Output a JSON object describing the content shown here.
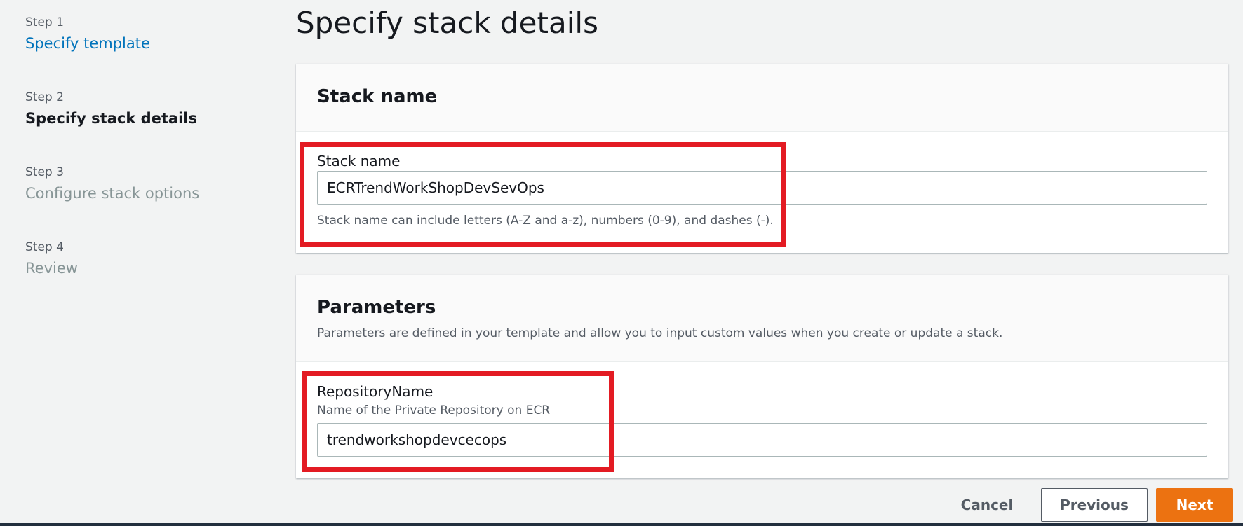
{
  "wizard": {
    "steps": [
      {
        "number": "Step 1",
        "title": "Specify template"
      },
      {
        "number": "Step 2",
        "title": "Specify stack details"
      },
      {
        "number": "Step 3",
        "title": "Configure stack options"
      },
      {
        "number": "Step 4",
        "title": "Review"
      }
    ]
  },
  "page": {
    "title": "Specify stack details"
  },
  "stack_name_section": {
    "header": "Stack name",
    "label": "Stack name",
    "value": "ECRTrendWorkShopDevSevOps",
    "hint": "Stack name can include letters (A-Z and a-z), numbers (0-9), and dashes (-)."
  },
  "parameters_section": {
    "header": "Parameters",
    "description": "Parameters are defined in your template and allow you to input custom values when you create or update a stack.",
    "repository": {
      "label": "RepositoryName",
      "description": "Name of the Private Repository on ECR",
      "value": "trendworkshopdevcecops"
    }
  },
  "footer": {
    "cancel_label": "Cancel",
    "previous_label": "Previous",
    "next_label": "Next"
  },
  "colors": {
    "link": "#0073bb",
    "primary_button": "#ec7211",
    "highlight": "#e31b23"
  }
}
